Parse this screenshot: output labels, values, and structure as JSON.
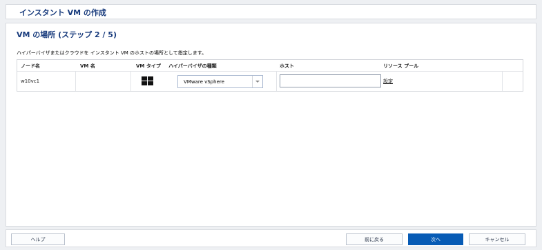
{
  "window": {
    "title": "インスタント VM の作成"
  },
  "step": {
    "title": "VM の場所 (ステップ 2 / 5)",
    "instruction": "ハイパーバイザまたはクラウドを インスタント VM のホストの場所として指定します。"
  },
  "table": {
    "columns": [
      "ノード名",
      "VM 名",
      "VM タイプ",
      "ハイパーバイザの種類",
      "ホスト",
      "リソース プール"
    ],
    "rows": [
      {
        "node_name": "w10vc1",
        "vm_name": "",
        "vm_type_icon": "windows-icon",
        "hypervisor_type": "VMware vSphere",
        "host": "",
        "resource_pool_link": "設定"
      }
    ]
  },
  "footer": {
    "help": "ヘルプ",
    "back": "前に戻る",
    "next": "次へ",
    "cancel": "キャンセル"
  },
  "colors": {
    "title": "#173a7c",
    "primary_button": "#075bb5",
    "background": "#eef0f3"
  }
}
